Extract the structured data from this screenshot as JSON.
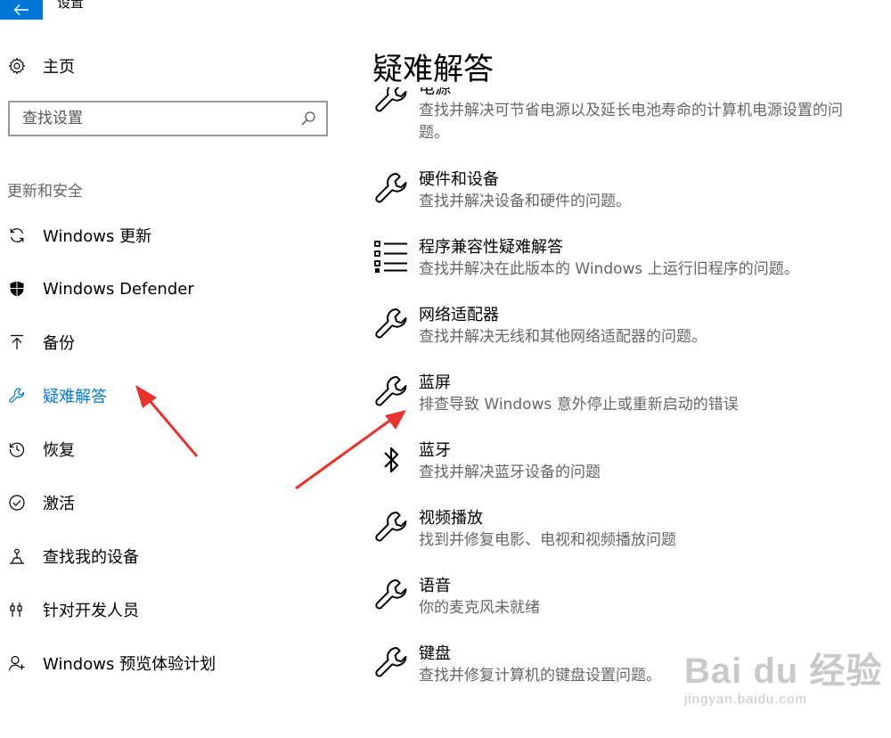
{
  "window": {
    "title": "设置"
  },
  "sidebar": {
    "home_label": "主页",
    "search_placeholder": "查找设置",
    "section_label": "更新和安全",
    "items": [
      {
        "label": "Windows 更新",
        "icon": "sync-icon"
      },
      {
        "label": "Windows Defender",
        "icon": "shield-icon"
      },
      {
        "label": "备份",
        "icon": "backup-arrow-icon"
      },
      {
        "label": "疑难解答",
        "icon": "wrench-icon",
        "active": true
      },
      {
        "label": "恢复",
        "icon": "history-icon"
      },
      {
        "label": "激活",
        "icon": "check-circle-icon"
      },
      {
        "label": "查找我的设备",
        "icon": "find-device-icon"
      },
      {
        "label": "针对开发人员",
        "icon": "developer-icon"
      },
      {
        "label": "Windows 预览体验计划",
        "icon": "insider-icon"
      }
    ]
  },
  "main": {
    "title": "疑难解答",
    "entries": [
      {
        "title": "电源",
        "desc": "查找并解决可节省电源以及延长电池寿命的计算机电源设置的问题。",
        "icon": "wrench-icon"
      },
      {
        "title": "硬件和设备",
        "desc": "查找并解决设备和硬件的问题。",
        "icon": "wrench-icon"
      },
      {
        "title": "程序兼容性疑难解答",
        "desc": "查找并解决在此版本的 Windows 上运行旧程序的问题。",
        "icon": "list-icon"
      },
      {
        "title": "网络适配器",
        "desc": "查找并解决无线和其他网络适配器的问题。",
        "icon": "wrench-icon"
      },
      {
        "title": "蓝屏",
        "desc": "排查导致 Windows 意外停止或重新启动的错误",
        "icon": "wrench-icon"
      },
      {
        "title": "蓝牙",
        "desc": "查找并解决蓝牙设备的问题",
        "icon": "bluetooth-icon"
      },
      {
        "title": "视频播放",
        "desc": "找到并修复电影、电视和视频播放问题",
        "icon": "wrench-icon"
      },
      {
        "title": "语音",
        "desc": "你的麦克风未就绪",
        "icon": "wrench-icon"
      },
      {
        "title": "键盘",
        "desc": "查找并修复计算机的键盘设置问题。",
        "icon": "wrench-icon"
      }
    ]
  },
  "watermark": {
    "main": "Bai du 经验",
    "sub": "jingyan.baidu.com"
  },
  "colors": {
    "accent": "#0078d7",
    "annotation_arrow": "#e8322e",
    "secondary_text": "#666666"
  }
}
